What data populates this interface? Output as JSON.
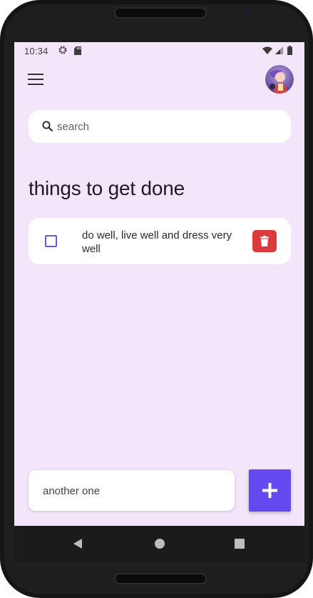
{
  "statusbar": {
    "time": "10:34",
    "icons": [
      "settings-icon",
      "sd-card-icon",
      "wifi-icon",
      "cell-signal-icon",
      "battery-icon"
    ]
  },
  "header": {
    "menu_icon": "hamburger-menu-icon",
    "avatar": "user-avatar"
  },
  "search": {
    "placeholder": "search",
    "value": "",
    "icon": "search-icon"
  },
  "main": {
    "title": "things to get done",
    "todos": [
      {
        "text": "do well, live well and dress very well",
        "checked": false
      }
    ]
  },
  "composer": {
    "input_value": "another one",
    "add_icon": "plus-icon"
  },
  "navigation": {
    "buttons": [
      "back-icon",
      "home-icon",
      "recents-icon"
    ]
  },
  "colors": {
    "background": "#f4e6fa",
    "accent": "#6448f0",
    "checkbox": "#6759e0",
    "delete": "#dc3b3d",
    "card": "#ffffff"
  }
}
